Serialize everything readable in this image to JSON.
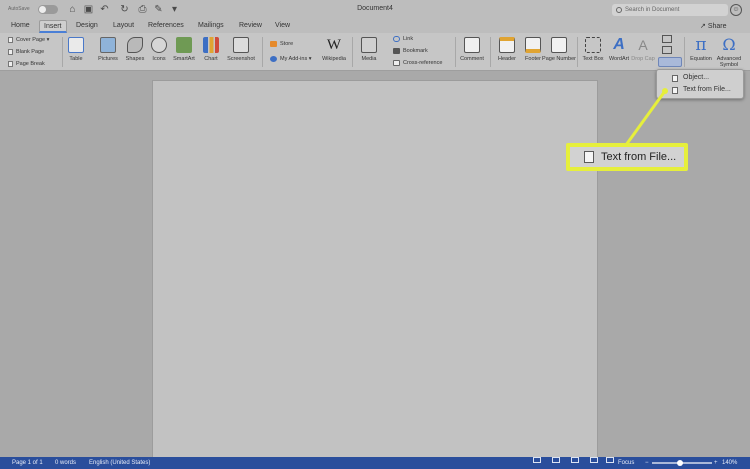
{
  "titlebar": {
    "autosave_label": "AutoSave",
    "autosave_toggle": "OFF",
    "document_title": "Document4",
    "search_placeholder": "Search in Document"
  },
  "tabs": [
    {
      "label": "Home"
    },
    {
      "label": "Insert",
      "active": true
    },
    {
      "label": "Design"
    },
    {
      "label": "Layout"
    },
    {
      "label": "References"
    },
    {
      "label": "Mailings"
    },
    {
      "label": "Review"
    },
    {
      "label": "View"
    }
  ],
  "share_label": "Share",
  "ribbon": {
    "pages": [
      "Cover Page",
      "Blank Page",
      "Page Break"
    ],
    "table": "Table",
    "pictures": "Pictures",
    "shapes": "Shapes",
    "icons": "Icons",
    "smartart": "SmartArt",
    "chart": "Chart",
    "screenshot": "Screenshot",
    "store": "Store",
    "my_addins": "My Add-ins",
    "wikipedia": "Wikipedia",
    "media": "Media",
    "link": "Link",
    "bookmark": "Bookmark",
    "cross_reference": "Cross-reference",
    "comment": "Comment",
    "header": "Header",
    "footer": "Footer",
    "page_number": "Page Number",
    "text_box": "Text Box",
    "wordart": "WordArt",
    "drop_cap": "Drop Cap",
    "equation": "Equation",
    "advanced_symbol": "Advanced Symbol"
  },
  "menu": {
    "object": "Object...",
    "text_from_file": "Text from File..."
  },
  "callout_label": "Text from File...",
  "status": {
    "page": "Page 1 of 1",
    "words": "0 words",
    "language": "English (United States)",
    "focus": "Focus",
    "zoom": "140%"
  },
  "colors": {
    "accent": "#2a4e9c",
    "callout": "#e6ef3c",
    "tab_underline": "#4a7fd6"
  }
}
